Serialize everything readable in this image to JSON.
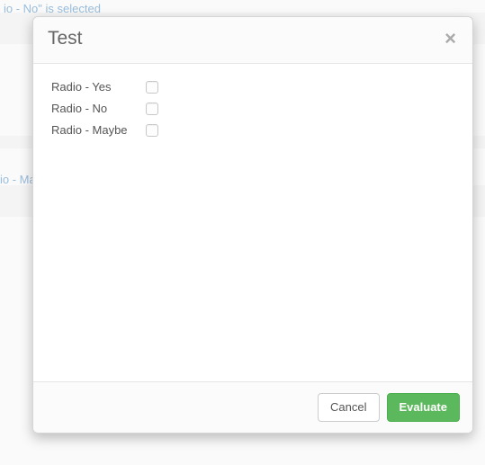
{
  "background": {
    "snippet_top": "io - No\" is selected",
    "snippet_mid": "io - Ma"
  },
  "modal": {
    "title": "Test",
    "options": [
      {
        "label": "Radio - Yes",
        "checked": false
      },
      {
        "label": "Radio - No",
        "checked": false
      },
      {
        "label": "Radio - Maybe",
        "checked": false
      }
    ],
    "buttons": {
      "cancel": "Cancel",
      "evaluate": "Evaluate"
    }
  }
}
